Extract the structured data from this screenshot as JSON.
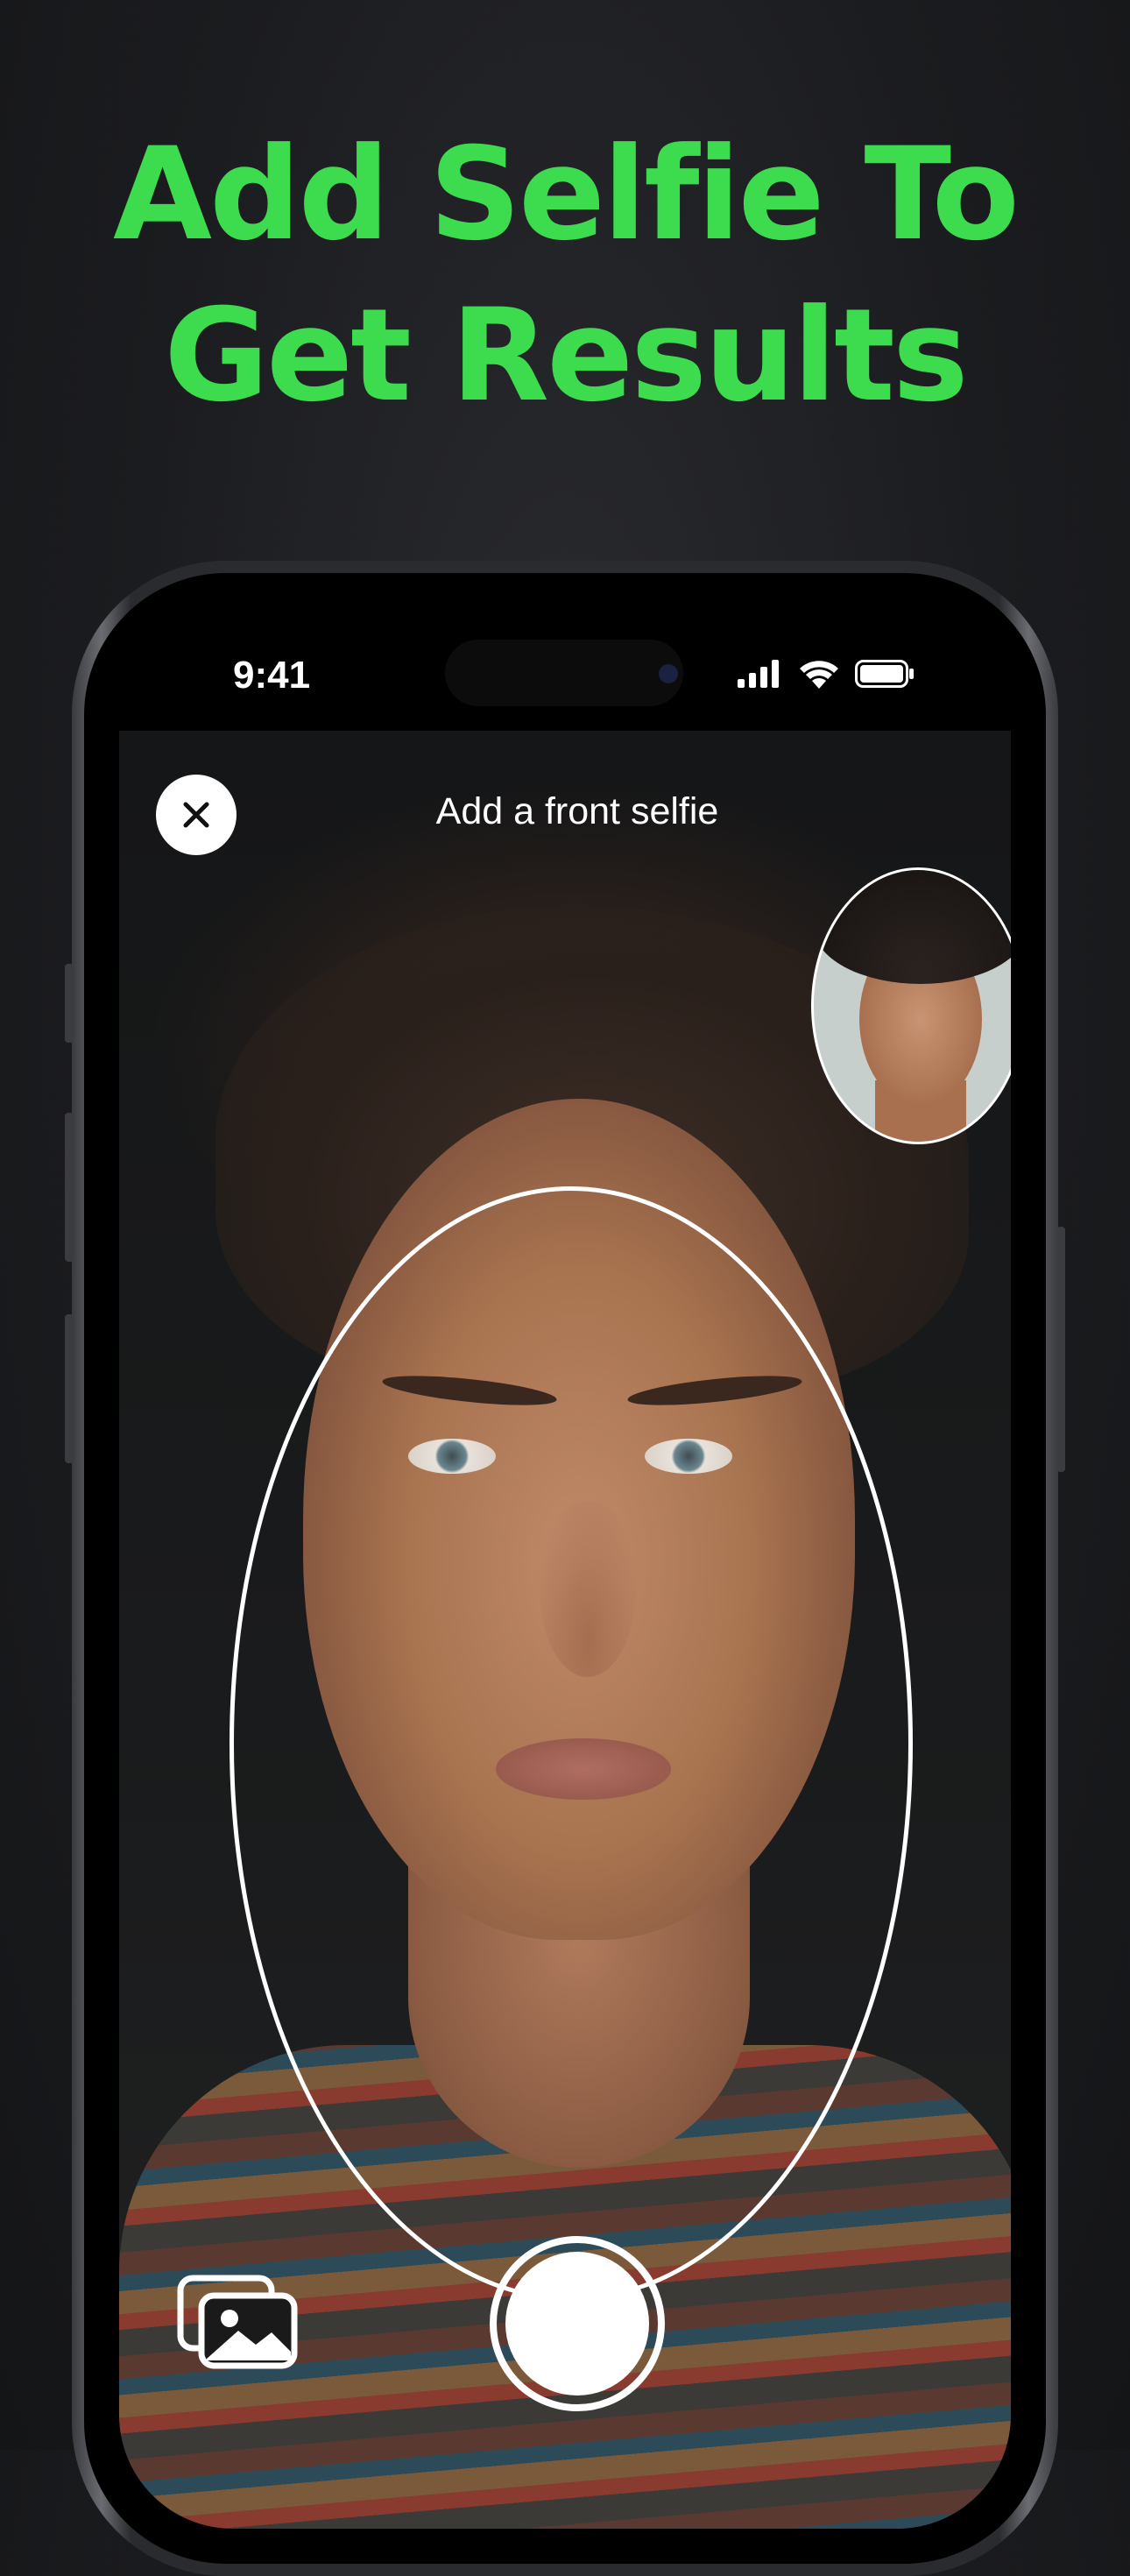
{
  "headline": {
    "line1": "Add Selfie To",
    "line2": "Get Results",
    "color": "#3ddc4e"
  },
  "status_bar": {
    "time": "9:41",
    "icons": [
      "cellular-signal-icon",
      "wifi-icon",
      "battery-icon"
    ]
  },
  "camera_screen": {
    "title": "Add a front selfie",
    "close_icon": "close-icon",
    "reference_photo": "reference-face-thumbnail",
    "gallery_icon": "photo-gallery-icon",
    "shutter": "shutter-button"
  }
}
